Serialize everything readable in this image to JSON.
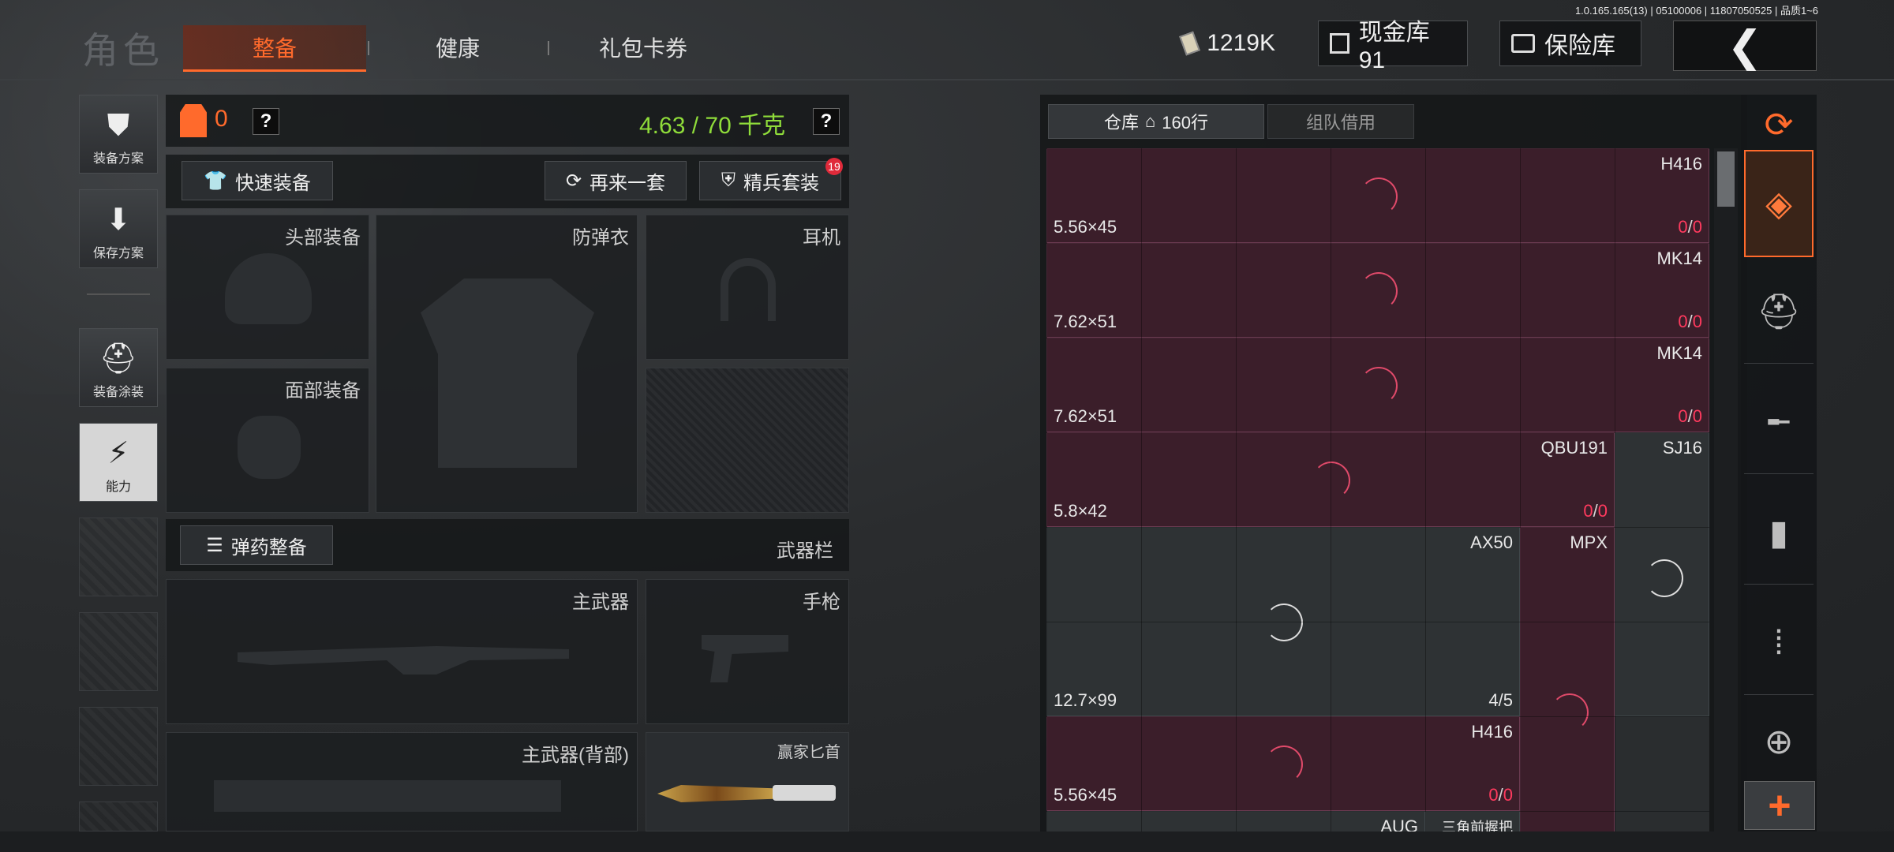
{
  "header": {
    "title": "角色",
    "tabs": [
      {
        "label": "整备",
        "active": true
      },
      {
        "label": "健康"
      },
      {
        "label": "礼包卡券"
      }
    ],
    "version": "1.0.165.165(13) | 05100006 | 11807050525 | 品质1~6",
    "currency": "1219K",
    "cash_vault": "现金库 91",
    "safe": "保险库",
    "back": "❮"
  },
  "left_nav": [
    {
      "label": "装备方案",
      "icon": "vest-icon"
    },
    {
      "label": "保存方案",
      "icon": "download-icon"
    },
    {
      "label": "装备涂装",
      "icon": "helmet-paint-icon"
    },
    {
      "label": "能力",
      "icon": "ability-icon",
      "active": true
    }
  ],
  "equip": {
    "armor_level": "0",
    "weight": "4.63 / 70 千克",
    "help": "?",
    "quick_equip": "快速装备",
    "another_set": "再来一套",
    "elite_set": "精兵套装",
    "elite_badge": "19",
    "slots": {
      "head": "头部装备",
      "vest": "防弹衣",
      "earphone": "耳机",
      "face": "面部装备",
      "primary": "主武器",
      "pistol": "手枪",
      "primary_back": "主武器(背部)",
      "knife": "赢家匕首"
    },
    "ammo_btn": "弹药整备",
    "weapon_bar": "武器栏"
  },
  "warehouse": {
    "tab_storage": "仓库",
    "storage_rows": "160行",
    "tab_team": "组队借用",
    "items": [
      {
        "name": "H416",
        "caliber": "5.56×45",
        "count_a": "0",
        "count_b": "0"
      },
      {
        "name": "MK14",
        "caliber": "7.62×51",
        "count_a": "0",
        "count_b": "0"
      },
      {
        "name": "MK14",
        "caliber": "7.62×51",
        "count_a": "0",
        "count_b": "0"
      },
      {
        "name": "QBU191",
        "caliber": "5.8×42",
        "count_a": "0",
        "count_b": "0"
      },
      {
        "name": "SJ16"
      },
      {
        "name": "AX50",
        "caliber": "12.7×99",
        "count": "4/5"
      },
      {
        "name": "MPX"
      },
      {
        "name": "H416",
        "caliber": "5.56×45",
        "count_a": "0",
        "count_b": "0"
      },
      {
        "name": "AUG"
      },
      {
        "name": "三角前握把"
      }
    ]
  },
  "rail": [
    "stack-refresh-icon",
    "layers-icon",
    "helmet-icon",
    "rifle-icon",
    "magazine-icon",
    "bullet-icon",
    "sight-icon",
    "plus-icon"
  ],
  "colors": {
    "accent": "#ff6a2c",
    "item_red": "#3b1e2a",
    "count_red": "#ff3a5e",
    "weight_green": "#8fdc3a"
  }
}
